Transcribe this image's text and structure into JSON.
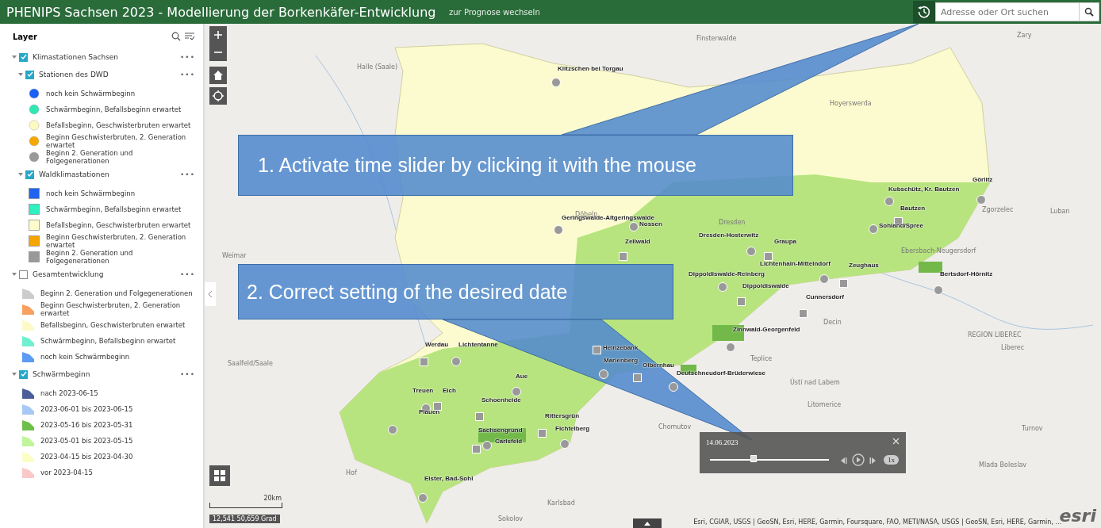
{
  "header": {
    "title": "PHENIPS Sachsen 2023 - Modellierung der Borkenkäfer-Entwicklung",
    "link": "zur Prognose wechseln",
    "search": {
      "placeholder": "Adresse oder Ort suchen"
    }
  },
  "layer_panel": {
    "title": "Layer",
    "menu": "•••",
    "groups": [
      {
        "label": "Klimastationen Sachsen",
        "checked": true,
        "expanded": true,
        "children": [
          {
            "label": "Stationen des DWD",
            "checked": true,
            "expanded": true,
            "legend": [
              {
                "label": "noch kein Schwärmbeginn",
                "kind": "circle",
                "color": "#1a5ff5"
              },
              {
                "label": "Schwärmbeginn, Befallsbeginn erwartet",
                "kind": "circle",
                "color": "#2ee8b4"
              },
              {
                "label": "Befallsbeginn, Geschwisterbruten erwartet",
                "kind": "circle",
                "color": "#fdfac0"
              },
              {
                "label": "Beginn Geschwisterbruten, 2. Generation erwartet",
                "kind": "circle",
                "color": "#f5a800"
              },
              {
                "label": "Beginn 2. Generation und Folgegenerationen",
                "kind": "circle",
                "color": "#999999"
              }
            ]
          },
          {
            "label": "Waldklimastationen",
            "checked": true,
            "expanded": true,
            "legend": [
              {
                "label": "noch kein Schwärmbeginn",
                "kind": "square",
                "color": "#1f63f0"
              },
              {
                "label": "Schwärmbeginn, Befallsbeginn erwartet",
                "kind": "square",
                "color": "#2ff0c0"
              },
              {
                "label": "Befallsbeginn, Geschwisterbruten erwartet",
                "kind": "square",
                "color": "#fffccc"
              },
              {
                "label": "Beginn Geschwisterbruten, 2. Generation erwartet",
                "kind": "square",
                "color": "#f5a500"
              },
              {
                "label": "Beginn 2. Generation und Folgegenerationen",
                "kind": "square",
                "color": "#999999"
              }
            ]
          }
        ]
      },
      {
        "label": "Gesamtentwicklung",
        "checked": false,
        "expanded": true,
        "legend": [
          {
            "label": "Beginn 2. Generation und Folgegenerationen",
            "kind": "area",
            "color": "#cccccc"
          },
          {
            "label": "Beginn Geschwisterbruten, 2. Generation erwartet",
            "kind": "area",
            "color": "#f7a060"
          },
          {
            "label": "Befallsbeginn, Geschwisterbruten erwartet",
            "kind": "area",
            "color": "#fdfac8"
          },
          {
            "label": "Schwärmbeginn, Befallsbeginn erwartet",
            "kind": "area",
            "color": "#70f0d0"
          },
          {
            "label": "noch kein Schwärmbeginn",
            "kind": "area",
            "color": "#5b9af5"
          }
        ]
      },
      {
        "label": "Schwärmbeginn",
        "checked": true,
        "expanded": true,
        "legend": [
          {
            "label": "nach 2023-06-15",
            "kind": "area",
            "color": "#4a5e9a"
          },
          {
            "label": "2023-06-01 bis 2023-06-15",
            "kind": "area",
            "color": "#a8c8f5"
          },
          {
            "label": "2023-05-16 bis 2023-05-31",
            "kind": "area",
            "color": "#6cc04a"
          },
          {
            "label": "2023-05-01 bis 2023-05-15",
            "kind": "area",
            "color": "#c0f59a"
          },
          {
            "label": "2023-04-15 bis 2023-04-30",
            "kind": "area",
            "color": "#fdfdc8"
          },
          {
            "label": "vor 2023-04-15",
            "kind": "area",
            "color": "#f9c9c9"
          }
        ]
      }
    ]
  },
  "map": {
    "stations": [
      {
        "name": "Klitzschen bei Torgau",
        "kind": "circle"
      },
      {
        "name": "Görlitz",
        "kind": "circle"
      },
      {
        "name": "Kubschütz, Kr. Bautzen",
        "kind": "circle"
      },
      {
        "name": "Bautzen",
        "kind": "square"
      },
      {
        "name": "Geringswalde-Altgeringswalde",
        "kind": "circle"
      },
      {
        "name": "Nossen",
        "kind": "circle"
      },
      {
        "name": "Sohland/Spree",
        "kind": "circle"
      },
      {
        "name": "Dresden-Hosterwitz",
        "kind": "circle"
      },
      {
        "name": "Zellwald",
        "kind": "square"
      },
      {
        "name": "Graupa",
        "kind": "square"
      },
      {
        "name": "Lichtenhain-Mittelndorf",
        "kind": "circle"
      },
      {
        "name": "Zeughaus",
        "kind": "square"
      },
      {
        "name": "Dippoldiswalde-Reinberg",
        "kind": "circle"
      },
      {
        "name": "Bertsdorf-Hörnitz",
        "kind": "circle"
      },
      {
        "name": "Dippoldiswalde",
        "kind": "square"
      },
      {
        "name": "Cunnersdorf",
        "kind": "square"
      },
      {
        "name": "Zinnwald-Georgenfeld",
        "kind": "circle"
      },
      {
        "name": "Werdau",
        "kind": "square"
      },
      {
        "name": "Lichtentanne",
        "kind": "circle"
      },
      {
        "name": "Heinzebank",
        "kind": "square"
      },
      {
        "name": "Marienberg",
        "kind": "circle"
      },
      {
        "name": "Olbernhau",
        "kind": "square"
      },
      {
        "name": "Deutschneudorf-Brüderwiese",
        "kind": "circle"
      },
      {
        "name": "Aue",
        "kind": "circle"
      },
      {
        "name": "Treuen",
        "kind": "circle"
      },
      {
        "name": "Eich",
        "kind": "square"
      },
      {
        "name": "Schoenheide",
        "kind": "square"
      },
      {
        "name": "Plauen",
        "kind": "circle"
      },
      {
        "name": "Rittersgrün",
        "kind": "square"
      },
      {
        "name": "Fichtelberg",
        "kind": "circle"
      },
      {
        "name": "Sachsengrund",
        "kind": "circle"
      },
      {
        "name": "Carlsfeld",
        "kind": "square"
      },
      {
        "name": "Elster, Bad-Sohl",
        "kind": "circle"
      }
    ],
    "places": [
      "Zary",
      "Finsterwalde",
      "Halle (Saale)",
      "Hoyerswerda",
      "Zgorzelec",
      "Luban",
      "Döbeln",
      "Dresden",
      "Ebersbach-Neugersdorf",
      "Weimar",
      "Decin",
      "REGION LIBEREC",
      "Liberec",
      "Teplice",
      "Saalfeld/Saale",
      "Ústí nad Labem",
      "Litomerice",
      "Chomutov",
      "Turnov",
      "Mlada Boleslav",
      "Hof",
      "Karlsbad",
      "Sokolov"
    ],
    "callouts": [
      "1.  Activate time slider by clicking it with the mouse",
      "2. Correct setting of the desired date"
    ],
    "time_slider": {
      "date": "14.06.2023",
      "level": 0.36,
      "speed": "1x"
    },
    "scale": "20km",
    "coordinates": "12,541 50,659 Grad",
    "attribution": "Esri, CGIAR, USGS | GeoSN, Esri, HERE, Garmin, Foursquare, FAO, METI/NASA, USGS | GeoSN, Esri, HERE, Garmin, ...",
    "logo": "esri"
  }
}
